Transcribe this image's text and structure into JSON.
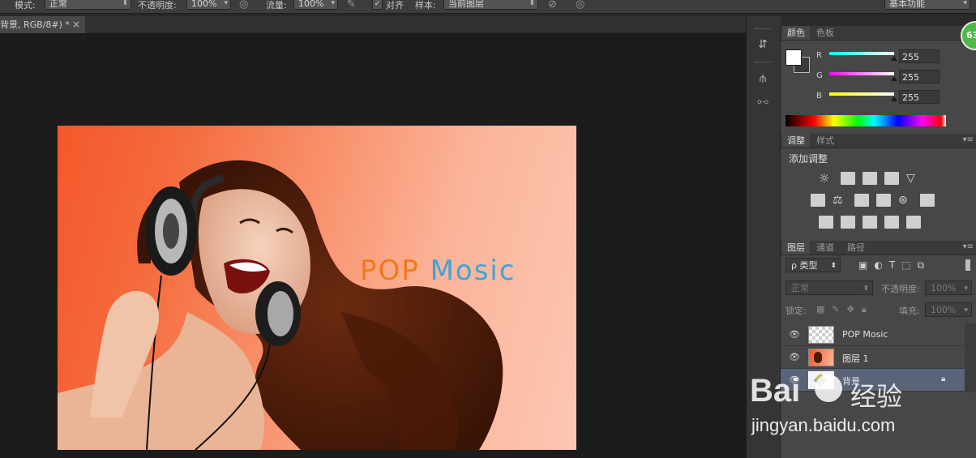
{
  "options_bar": {
    "mode_label": "模式:",
    "mode_value": "正常",
    "opacity_label": "不透明度:",
    "opacity_value": "100%",
    "flow_label": "流量:",
    "flow_value": "100%",
    "align_label": "对齐",
    "align_checked": true,
    "sample_label": "样本:",
    "sample_value": "当前图层",
    "workspace_value": "基本功能"
  },
  "document": {
    "tab_title": "背景, RGB/8#) *",
    "close_glyph": "×",
    "canvas_text": "POP Mosic",
    "canvas_text_colors": [
      "#f07a1a",
      "#3aa6d8"
    ]
  },
  "dock": {
    "collapse_glyph": "◂◂",
    "badge": "63"
  },
  "color_panel": {
    "tabs": [
      "颜色",
      "色板"
    ],
    "r_label": "R",
    "g_label": "G",
    "b_label": "B",
    "r_value": "255",
    "g_value": "255",
    "b_value": "255"
  },
  "adjustments_panel": {
    "tabs": [
      "调整",
      "样式"
    ],
    "add_label": "添加调整"
  },
  "layers_panel": {
    "tabs": [
      "图层",
      "通道",
      "路径"
    ],
    "filter_value": "ρ 类型",
    "blend_value": "正常",
    "opacity_label": "不透明度:",
    "opacity_value": "100%",
    "lock_label": "锁定:",
    "fill_label": "填充:",
    "fill_value": "100%",
    "layers": [
      {
        "name": "POP Mosic",
        "selected": false,
        "locked": false
      },
      {
        "name": "图层 1",
        "selected": false,
        "locked": false
      },
      {
        "name": "背景",
        "selected": true,
        "locked": true
      }
    ]
  },
  "watermark": {
    "brand": "Bai",
    "brand_suffix": "经验",
    "url": "jingyan.baidu.com"
  }
}
